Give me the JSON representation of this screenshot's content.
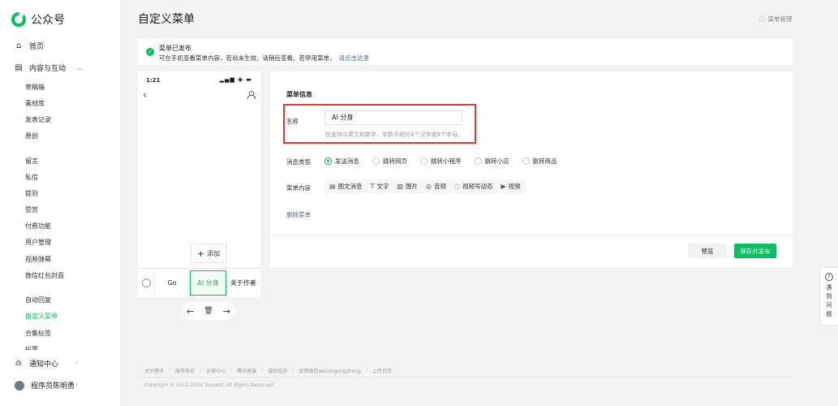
{
  "app": {
    "name": "公众号",
    "brand_color": "#07c160",
    "link_color": "#576b95",
    "highlight_color": "#e23a3a"
  },
  "sidebar": {
    "home": {
      "label": "首页",
      "icon": "home-icon"
    },
    "content": {
      "label": "内容与互动",
      "icon": "document-icon",
      "expanded": true
    },
    "items": [
      {
        "label": "草稿箱"
      },
      {
        "label": "素材库"
      },
      {
        "label": "发表记录"
      },
      {
        "label": "原创"
      },
      {
        "label": "留言"
      },
      {
        "label": "私信"
      },
      {
        "label": "提到"
      },
      {
        "label": "赞赏"
      },
      {
        "label": "付费功能"
      },
      {
        "label": "用户管理"
      },
      {
        "label": "视频弹幕"
      },
      {
        "label": "微信红包封面"
      },
      {
        "label": "自动回复"
      },
      {
        "label": "自定义菜单",
        "active": true
      },
      {
        "label": "合集标签"
      },
      {
        "label": "投票"
      }
    ],
    "notifications": {
      "label": "通知中心",
      "icon": "bell-icon"
    },
    "account": {
      "label": "程序员陈明勇"
    }
  },
  "header": {
    "title": "自定义菜单",
    "manage_label": "菜单管理"
  },
  "notice": {
    "title": "菜单已发布",
    "desc": "可在手机查看菜单内容，若尚未生效，请稍后查看。若停用菜单，",
    "link": "请点击这里"
  },
  "phone": {
    "time": "1:21",
    "status": "▂▄▆ ◉ ▬",
    "add_label": "添加",
    "menu_items": [
      {
        "label": "Go"
      },
      {
        "label": "AI 分身",
        "active": true
      },
      {
        "label": "关于作者"
      }
    ],
    "tools": {
      "left": "←",
      "trash": "🗑",
      "right": "→"
    }
  },
  "editor": {
    "section_title": "菜单信息",
    "name_label": "名称",
    "name_value": "AI 分身",
    "name_hint": "仅支持中英文和数字，字数不超过4个汉字或8个字母。",
    "msg_type_label": "消息类型",
    "msg_types": [
      {
        "label": "发送消息",
        "checked": true
      },
      {
        "label": "跳转网页"
      },
      {
        "label": "跳转小程序"
      },
      {
        "label": "跳转小店"
      },
      {
        "label": "跳转商品"
      }
    ],
    "content_label": "菜单内容",
    "content_types": [
      {
        "icon": "▤",
        "label": "图文消息"
      },
      {
        "icon": "T",
        "label": "文字"
      },
      {
        "icon": "▨",
        "label": "图片"
      },
      {
        "icon": "◎",
        "label": "音频"
      },
      {
        "icon": "◌",
        "label": "视频号动态"
      },
      {
        "icon": "▶",
        "label": "视频"
      }
    ],
    "delete_label": "删除菜单",
    "preview_label": "预览",
    "publish_label": "保存并发布"
  },
  "help": {
    "icon": "?",
    "text": "遇到问题"
  },
  "footer": {
    "links": [
      "关于腾讯",
      "服务协议",
      "运营中心",
      "腾讯客服",
      "侵权投诉",
      "反馈微信weixingongzhong",
      "上传日志"
    ],
    "copyright": "Copyright © 2012-2024 Tencent. All Rights Reserved."
  }
}
